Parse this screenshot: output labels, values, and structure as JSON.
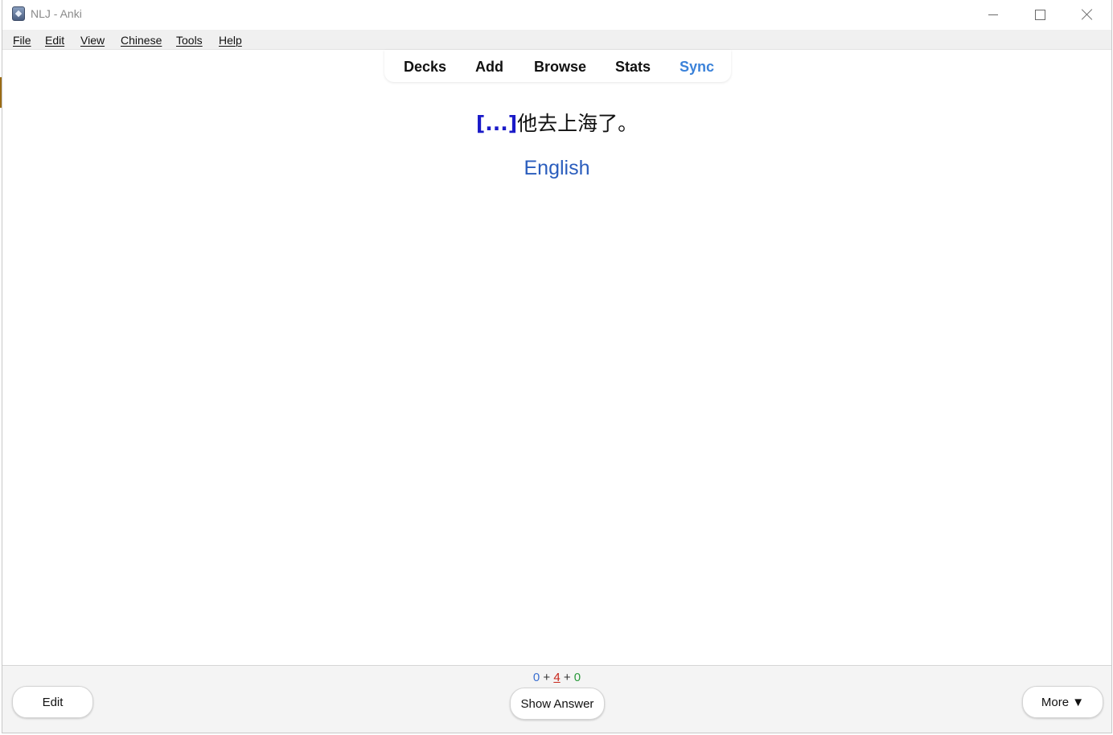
{
  "window": {
    "title": "NLJ - Anki"
  },
  "menu": {
    "items": [
      "File",
      "Edit",
      "View",
      "Chinese",
      "Tools",
      "Help"
    ]
  },
  "toolbar": {
    "decks": "Decks",
    "add": "Add",
    "browse": "Browse",
    "stats": "Stats",
    "sync": "Sync",
    "sync_color": "#3b82d9"
  },
  "card": {
    "cloze": "[...]",
    "sentence": "他去上海了。",
    "hint": "English",
    "cloze_color": "#1a1ac8"
  },
  "footer": {
    "count_new": "0",
    "plus1": "+",
    "count_learn": "4",
    "plus2": "+",
    "count_review": "0",
    "edit_label": "Edit",
    "show_answer_label": "Show Answer",
    "more_label": "More ▼"
  },
  "colors": {
    "new": "#3b6fd1",
    "learn": "#c8261b",
    "review": "#2a9a3b"
  }
}
